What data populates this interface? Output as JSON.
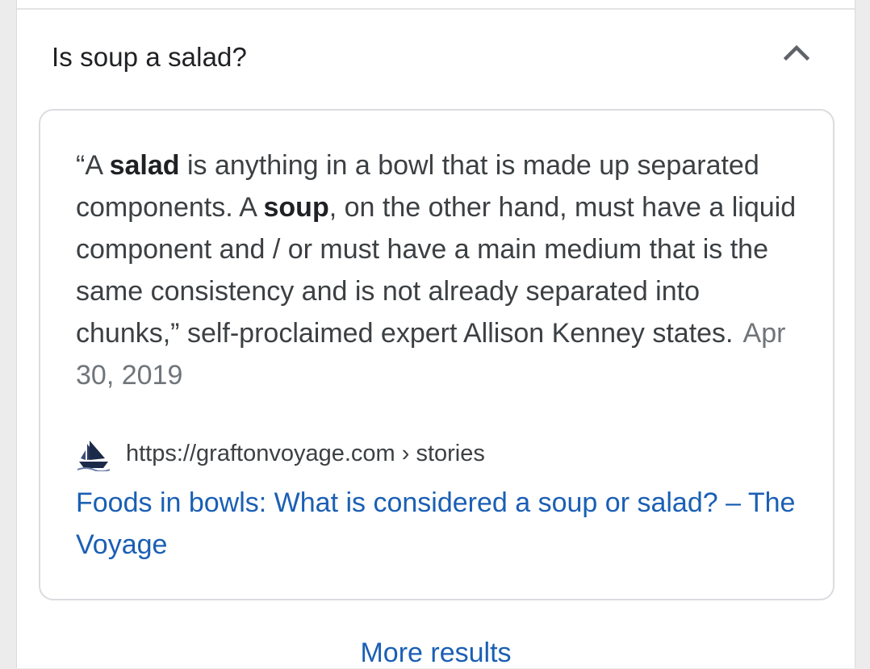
{
  "question": {
    "text": "Is soup a salad?",
    "expanded": true,
    "toggle_icon": "chevron-up-icon"
  },
  "answer": {
    "parts": [
      "“A ",
      "salad",
      " is anything in a bowl that is made up separated components. A ",
      "soup",
      ", on the other hand, must have a liquid component and / or must have a main medium that is the same consistency and is not already separated into chunks,” self-proclaimed expert Allison Kenney states."
    ],
    "date": "Apr 30, 2019"
  },
  "source": {
    "favicon": "ship-icon",
    "url": "https://graftonvoyage.com › stories",
    "title": "Foods in bowls: What is considered a soup or salad? – The Voyage"
  },
  "more_results_label": "More results",
  "colors": {
    "link": "#1a5fb4",
    "text": "#3c4043",
    "muted": "#70757a",
    "border": "#dadce0"
  }
}
